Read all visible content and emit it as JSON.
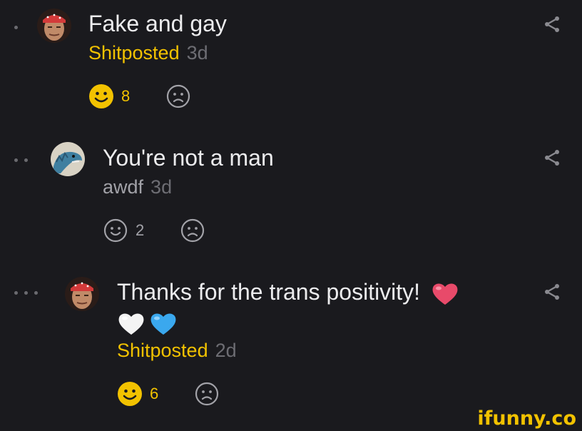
{
  "comments": [
    {
      "text": "Fake and gay",
      "username": "Shitposted",
      "username_color": "#f2c200",
      "time": "3d",
      "smile_count": "8",
      "smile_active": true,
      "avatar_icon": "bandana-man-avatar",
      "share_icon": "share-icon",
      "depth": 1
    },
    {
      "text": "You're not a man",
      "username": "awdf",
      "username_color": "#a2a2a8",
      "time": "3d",
      "smile_count": "2",
      "smile_active": false,
      "avatar_icon": "lizard-avatar",
      "share_icon": "share-icon",
      "depth": 2
    },
    {
      "text": "Thanks for the trans positivity!",
      "text_emojis": [
        "red-heart",
        "white-heart",
        "blue-heart"
      ],
      "username": "Shitposted",
      "username_color": "#f2c200",
      "time": "2d",
      "smile_count": "6",
      "smile_active": true,
      "avatar_icon": "bandana-man-avatar",
      "share_icon": "share-icon",
      "depth": 3
    }
  ],
  "colors": {
    "background": "#1a1a1e",
    "accent": "#f2c200",
    "text": "#ececee",
    "muted": "#6d6d73"
  },
  "watermark": "ifunny.co"
}
